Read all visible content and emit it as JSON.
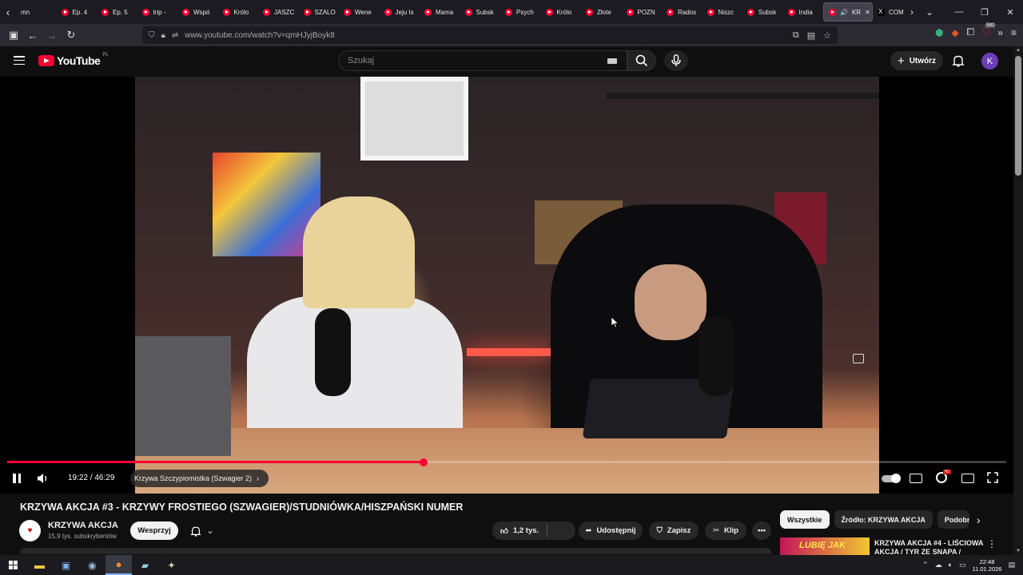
{
  "browser": {
    "tabs": [
      {
        "title": "mn"
      },
      {
        "title": "Ep. 4"
      },
      {
        "title": "Ep. 5"
      },
      {
        "title": "trip -"
      },
      {
        "title": "Wspó"
      },
      {
        "title": "Królo"
      },
      {
        "title": "JASZC"
      },
      {
        "title": "SZALO"
      },
      {
        "title": "Wene"
      },
      {
        "title": "Jeju Is"
      },
      {
        "title": "Mama"
      },
      {
        "title": "Subsk"
      },
      {
        "title": "Psych"
      },
      {
        "title": "Królo"
      },
      {
        "title": "Złote"
      },
      {
        "title": "POZN"
      },
      {
        "title": "Rados"
      },
      {
        "title": "Niszc"
      },
      {
        "title": "Subsk"
      },
      {
        "title": "India"
      }
    ],
    "active_tab": {
      "title": "KR"
    },
    "x_tab": {
      "title": "COME"
    },
    "url": "www.youtube.com/watch?v=qmHJyjBoyk8",
    "extension_badge": "582"
  },
  "youtube": {
    "logo_text": "YouTube",
    "country_code": "PL",
    "search_placeholder": "Szukaj",
    "create_label": "Utwórz",
    "avatar_letter": "K"
  },
  "player": {
    "time_current": "19:22",
    "time_total": "46:29",
    "time_display": "19:22 / 46:29",
    "progress_fraction": 0.4166,
    "chapter": "Krzywa Szczypiomistka (Szwagier 2)",
    "hd_badge": "HD"
  },
  "video": {
    "title": "KRZYWA AKCJA #3 - KRZYWY FROSTIEGO (SZWAGIER)/STUDNIÓWKA/HISZPAŃSKI NUMER",
    "channel_name": "KRZYWA AKCJA",
    "subscribers": "15,9 tys. subskrybentów",
    "support_label": "Wesprzyj",
    "likes": "1,2 tys.",
    "share_label": "Udostępnij",
    "save_label": "Zapisz",
    "clip_label": "Klip"
  },
  "sidebar": {
    "chips": [
      "Wszystkie",
      "Źródło: KRZYWA AKCJA",
      "Podobne"
    ],
    "recommendation": {
      "thumb_text": "LUBIĘ JAK",
      "title": "KRZYWA AKCJA #4 - LIŚCIOWA AKCJA / TYR ZE SNAPA /"
    }
  },
  "taskbar": {
    "time": "22:48",
    "date": "11.01.2026"
  },
  "colors": {
    "youtube_red": "#ff0033",
    "background": "#0f0f0f",
    "pill": "#272727",
    "avatar": "#6a3fb5"
  }
}
